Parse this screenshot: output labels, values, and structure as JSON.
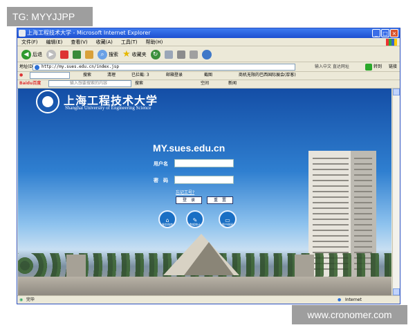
{
  "tag": "TG: MYYJJPP",
  "watermark": "www.cronomer.com",
  "window": {
    "title": "上海工程技术大学 - Microsoft Internet Explorer",
    "buttons": [
      "_",
      "□",
      "×"
    ]
  },
  "menu": [
    "文件(F)",
    "编辑(E)",
    "查看(V)",
    "收藏(A)",
    "工具(T)",
    "帮助(H)"
  ],
  "toolbar": {
    "back": "后退",
    "search": "搜索",
    "favorites": "收藏夹"
  },
  "address": {
    "label": "地址(D)",
    "url": "http://my.sues.edu.cn/index.jsp",
    "hint": "输入中文 直达网址",
    "go": "转到",
    "links": "链接"
  },
  "bar3": {
    "search": "搜索",
    "clean": "清理",
    "blocked": "已拦截: 3",
    "mail": "邮箱登录",
    "screenshot": "截图",
    "promo": "商机无限的巴西国际展会(厚客)"
  },
  "bar4": {
    "brand": "Baidu百度",
    "placeholder": "输入想要搜索的内容",
    "search": "搜索",
    "space": "空间",
    "news": "新闻"
  },
  "page": {
    "university_cn": "上海工程技术大学",
    "university_en": "Shanghai University of Engineering Science",
    "site": "MY.sues.edu.cn",
    "username_label": "用户名",
    "password_label": "密　码",
    "forgot": "忘记工号?",
    "login": "登　录",
    "reset": "重　置",
    "quick_links": [
      "服务指南",
      "数据统计",
      "图书借阅"
    ]
  },
  "status": {
    "left": "完毕",
    "zone": "Internet"
  }
}
